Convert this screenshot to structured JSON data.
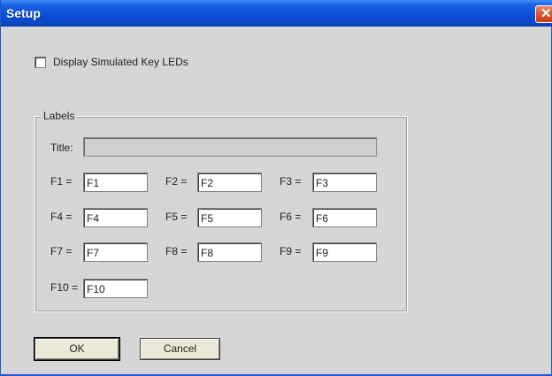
{
  "window": {
    "title": "Setup",
    "close_label": "✕"
  },
  "options": {
    "display_leds_label": "Display Simulated Key LEDs",
    "display_leds_checked": false
  },
  "labels_group": {
    "legend": "Labels",
    "title_label": "Title:",
    "title_value": ""
  },
  "fields": [
    {
      "label": "F1 =",
      "value": "F1"
    },
    {
      "label": "F2 =",
      "value": "F2"
    },
    {
      "label": "F3 =",
      "value": "F3"
    },
    {
      "label": "F4 =",
      "value": "F4"
    },
    {
      "label": "F5 =",
      "value": "F5"
    },
    {
      "label": "F6 =",
      "value": "F6"
    },
    {
      "label": "F7 =",
      "value": "F7"
    },
    {
      "label": "F8 =",
      "value": "F8"
    },
    {
      "label": "F9 =",
      "value": "F9"
    },
    {
      "label": "F10 =",
      "value": "F10"
    }
  ],
  "buttons": {
    "ok": "OK",
    "cancel": "Cancel"
  }
}
